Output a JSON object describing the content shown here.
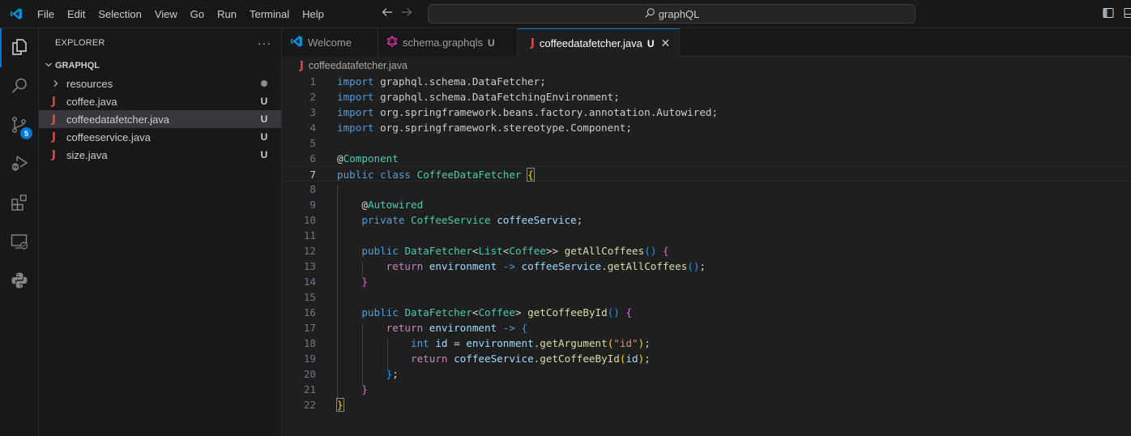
{
  "titlebar": {
    "menu": [
      "File",
      "Edit",
      "Selection",
      "View",
      "Go",
      "Run",
      "Terminal",
      "Help"
    ],
    "search_text": "graphQL",
    "back_icon": "arrow-left-icon",
    "forward_icon": "arrow-right-icon"
  },
  "activitybar": {
    "items": [
      {
        "name": "explorer",
        "icon": "files-icon",
        "active": true
      },
      {
        "name": "search",
        "icon": "search-icon"
      },
      {
        "name": "source-control",
        "icon": "source-control-icon",
        "badge": "5"
      },
      {
        "name": "run-debug",
        "icon": "run-debug-icon"
      },
      {
        "name": "extensions",
        "icon": "extensions-icon"
      },
      {
        "name": "remote-explorer",
        "icon": "remote-explorer-icon"
      },
      {
        "name": "python",
        "icon": "python-icon"
      }
    ]
  },
  "sidebar": {
    "title": "EXPLORER",
    "more": "···",
    "root": "GRAPHQL",
    "items": [
      {
        "label": "resources",
        "type": "folder",
        "status": "dot"
      },
      {
        "label": "coffee.java",
        "type": "java",
        "status": "U"
      },
      {
        "label": "coffeedatafetcher.java",
        "type": "java",
        "status": "U",
        "selected": true
      },
      {
        "label": "coffeeservice.java",
        "type": "java",
        "status": "U"
      },
      {
        "label": "size.java",
        "type": "java",
        "status": "U"
      }
    ]
  },
  "tabs": [
    {
      "label": "Welcome",
      "icon": "vscode-icon",
      "status": ""
    },
    {
      "label": "schema.graphqls",
      "icon": "graphql-icon",
      "status": "U"
    },
    {
      "label": "coffeedatafetcher.java",
      "icon": "java-icon",
      "status": "U",
      "active": true,
      "close": "✕"
    }
  ],
  "breadcrumb": {
    "file": "coffeedatafetcher.java"
  },
  "editor": {
    "current_line": 7,
    "line_numbers": [
      "1",
      "2",
      "3",
      "4",
      "5",
      "6",
      "7",
      "8",
      "9",
      "10",
      "11",
      "12",
      "13",
      "14",
      "15",
      "16",
      "17",
      "18",
      "19",
      "20",
      "21",
      "22"
    ],
    "lines": [
      "import graphql.schema.DataFetcher;",
      "import graphql.schema.DataFetchingEnvironment;",
      "import org.springframework.beans.factory.annotation.Autowired;",
      "import org.springframework.stereotype.Component;",
      "",
      "@Component",
      "public class CoffeeDataFetcher {",
      "",
      "    @Autowired",
      "    private CoffeeService coffeeService;",
      "",
      "    public DataFetcher<List<Coffee>> getAllCoffees() {",
      "        return environment -> coffeeService.getAllCoffees();",
      "    }",
      "",
      "    public DataFetcher<Coffee> getCoffeeById() {",
      "        return environment -> {",
      "            int id = environment.getArgument(\"id\");",
      "            return coffeeService.getCoffeeById(id);",
      "        };",
      "    }",
      "}"
    ]
  }
}
